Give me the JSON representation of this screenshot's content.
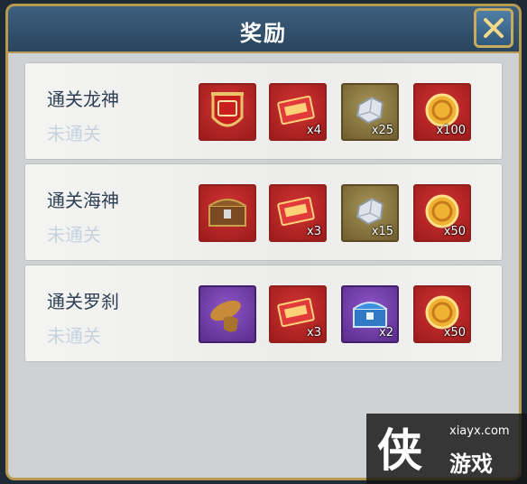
{
  "dialog": {
    "title": "奖励"
  },
  "colors": {
    "frame": "#b89a4e",
    "titlebar": "#2f4c68",
    "slot_red": "#b52424",
    "slot_gold": "#8a7840",
    "slot_purple": "#6e3ea8"
  },
  "rows": [
    {
      "title": "通关龙神",
      "status": "未通关",
      "rewards": [
        {
          "icon": "red-shield-badge-icon",
          "qty": ""
        },
        {
          "icon": "red-ticket-icon",
          "qty": "x4"
        },
        {
          "icon": "silver-ore-icon",
          "qty": "x25"
        },
        {
          "icon": "gold-coin-icon",
          "qty": "x100"
        }
      ]
    },
    {
      "title": "通关海神",
      "status": "未通关",
      "rewards": [
        {
          "icon": "treasure-chest-icon",
          "qty": ""
        },
        {
          "icon": "red-ticket-icon",
          "qty": "x3"
        },
        {
          "icon": "silver-ore-icon",
          "qty": "x15"
        },
        {
          "icon": "gold-coin-icon",
          "qty": "x50"
        }
      ]
    },
    {
      "title": "通关罗刹",
      "status": "未通关",
      "rewards": [
        {
          "icon": "bread-sack-icon",
          "qty": ""
        },
        {
          "icon": "red-ticket-icon",
          "qty": "x3"
        },
        {
          "icon": "blue-chest-icon",
          "qty": "x2"
        },
        {
          "icon": "gold-coin-icon",
          "qty": "x50"
        }
      ]
    }
  ],
  "watermark": {
    "url": "xiayx.com",
    "name": "游戏",
    "logo_char": "侠"
  }
}
